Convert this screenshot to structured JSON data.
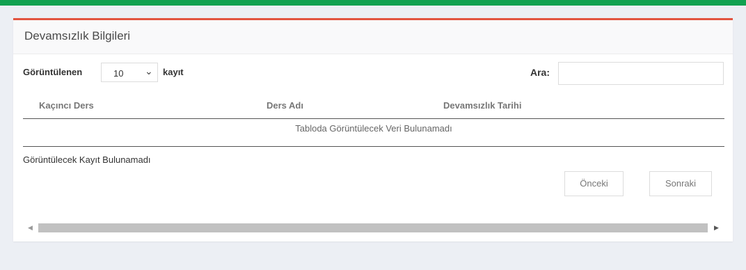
{
  "panel": {
    "title": "Devamsızlık Bilgileri"
  },
  "length_menu": {
    "prefix": "Görüntülenen",
    "selected": "10",
    "suffix": "kayıt"
  },
  "search": {
    "label": "Ara:",
    "value": ""
  },
  "table": {
    "columns": [
      "Kaçıncı Ders",
      "Ders Adı",
      "Devamsızlık Tarihi"
    ],
    "empty_message": "Tabloda Görüntülecek Veri Bulunamadı"
  },
  "info": "Görüntülecek Kayıt Bulunamadı",
  "pagination": {
    "previous": "Önceki",
    "next": "Sonraki"
  },
  "colors": {
    "top_bar": "#12a150",
    "panel_accent": "#e2533f"
  },
  "icons": {
    "select": "chevron-down-icon",
    "scroll_left": "triangle-left-icon",
    "scroll_right": "triangle-right-icon"
  }
}
